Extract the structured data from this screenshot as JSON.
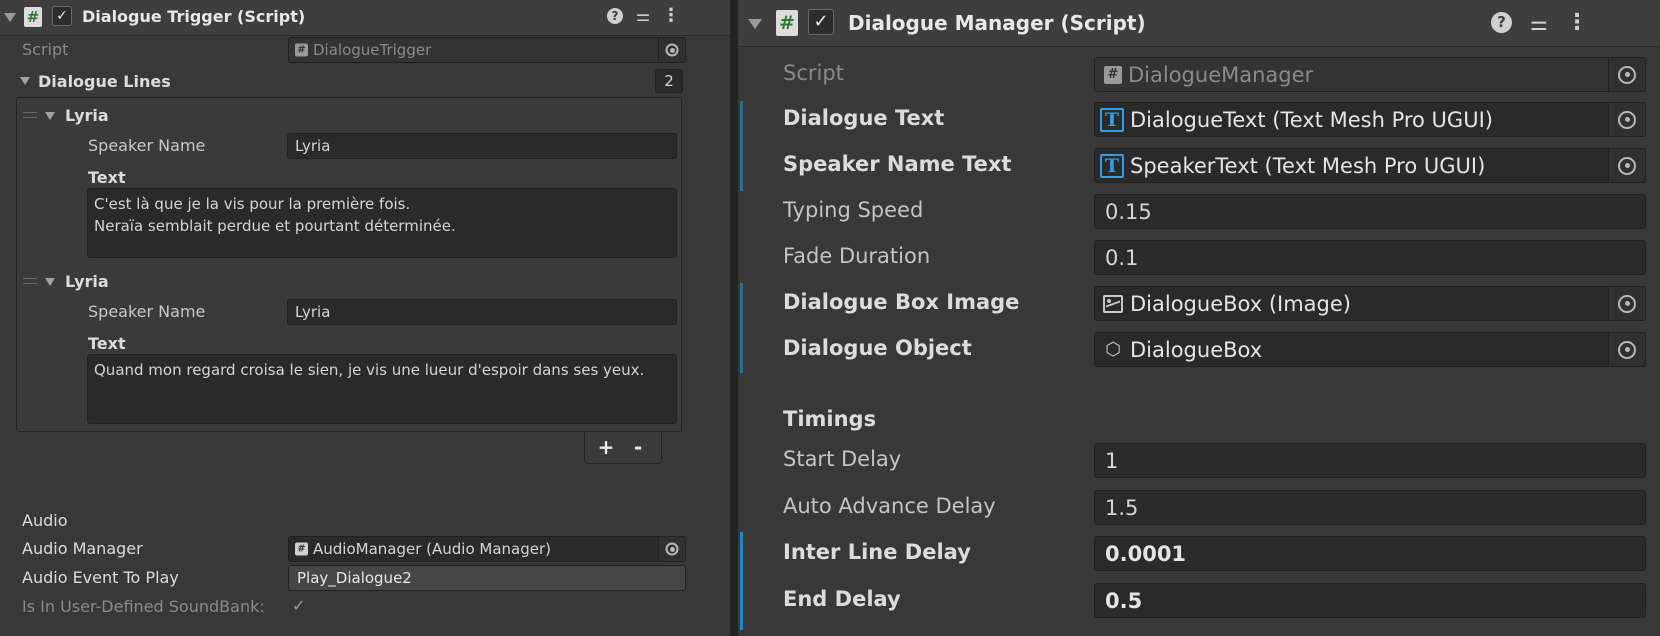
{
  "left": {
    "header": {
      "title": "Dialogue Trigger (Script)"
    },
    "script": {
      "label": "Script",
      "value": "DialogueTrigger"
    },
    "dialogue_lines": {
      "label": "Dialogue Lines",
      "count": "2",
      "items": [
        {
          "title": "Lyria",
          "speaker_label": "Speaker Name",
          "speaker_value": "Lyria",
          "text_label": "Text",
          "text_value": "C'est là que je la vis pour la première fois.\nNeraïa semblait perdue et pourtant déterminée."
        },
        {
          "title": "Lyria",
          "speaker_label": "Speaker Name",
          "speaker_value": "Lyria",
          "text_label": "Text",
          "text_value": "Quand mon regard croisa le sien, je vis une lueur d'espoir dans ses yeux."
        }
      ],
      "add_label": "+",
      "remove_label": "-"
    },
    "audio": {
      "section_label": "Audio",
      "manager_label": "Audio Manager",
      "manager_value": "AudioManager (Audio Manager)",
      "event_label": "Audio Event To Play",
      "event_value": "Play_Dialogue2",
      "soundbank_label": "Is In User-Defined SoundBank:"
    }
  },
  "right": {
    "header": {
      "title": "Dialogue Manager (Script)"
    },
    "script": {
      "label": "Script",
      "value": "DialogueManager"
    },
    "fields": [
      {
        "label": "Dialogue Text",
        "value": "DialogueText (Text Mesh Pro UGUI)",
        "icon": "text-mesh-pro-icon"
      },
      {
        "label": "Speaker Name Text",
        "value": "SpeakerText (Text Mesh Pro UGUI)",
        "icon": "text-mesh-pro-icon"
      },
      {
        "label": "Typing Speed",
        "value": "0.15"
      },
      {
        "label": "Fade Duration",
        "value": "0.1"
      },
      {
        "label": "Dialogue Box Image",
        "value": "DialogueBox (Image)",
        "icon": "image-icon"
      },
      {
        "label": "Dialogue Object",
        "value": "DialogueBox",
        "icon": "cube-icon"
      }
    ],
    "timings": {
      "section_label": "Timings",
      "fields": [
        {
          "label": "Start Delay",
          "value": "1"
        },
        {
          "label": "Auto Advance Delay",
          "value": "1.5"
        },
        {
          "label": "Inter Line Delay",
          "value": "0.0001"
        },
        {
          "label": "End Delay",
          "value": "0.5"
        }
      ]
    }
  },
  "header_icons": {
    "help": "?",
    "check": "✓",
    "hash": "#",
    "menu": "⋮"
  }
}
